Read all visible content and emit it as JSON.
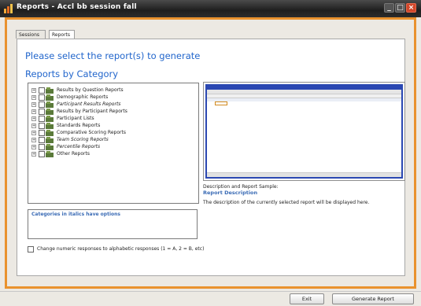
{
  "window": {
    "title": "Reports - Accl bb session fall"
  },
  "tabs": [
    {
      "label": "Sessions"
    },
    {
      "label": "Reports"
    }
  ],
  "main": {
    "heading": "Please select the report(s) to generate",
    "subheading": "Reports by Category",
    "tree": [
      {
        "label": "Results by Question Reports",
        "italic": false
      },
      {
        "label": "Demographic Reports",
        "italic": false
      },
      {
        "label": "Participant Results Reports",
        "italic": true
      },
      {
        "label": "Results by Participant Reports",
        "italic": false
      },
      {
        "label": "Participant Lists",
        "italic": false
      },
      {
        "label": "Standards Reports",
        "italic": false
      },
      {
        "label": "Comparative Scoring Reports",
        "italic": false
      },
      {
        "label": "Team Scoring Reports",
        "italic": true
      },
      {
        "label": "Percentile Reports",
        "italic": true
      },
      {
        "label": "Other Reports",
        "italic": false
      }
    ],
    "hint": "Categories in italics have options",
    "preview_caption": "Description and Report Sample:",
    "report_description_title": "Report Description",
    "report_description_body": "The description of the currently selected report will be displayed here.",
    "checkbox_label": "Change numeric responses to alphabetic responses (1 = A, 2 = B, etc)"
  },
  "footer": {
    "exit_label": "Exit",
    "generate_label": "Generate Report"
  },
  "colors": {
    "accent": "#e9922e",
    "heading": "#2266cc",
    "link": "#3a6bb5",
    "sample_border": "#2b48b2"
  }
}
